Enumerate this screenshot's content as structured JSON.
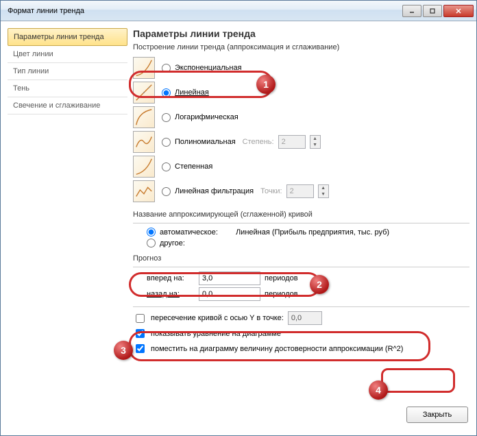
{
  "window": {
    "title": "Формат линии тренда"
  },
  "sidebar": {
    "items": [
      {
        "label": "Параметры линии тренда"
      },
      {
        "label": "Цвет линии"
      },
      {
        "label": "Тип линии"
      },
      {
        "label": "Тень"
      },
      {
        "label": "Свечение и сглаживание"
      }
    ]
  },
  "content": {
    "heading": "Параметры линии тренда",
    "build_group": "Построение линии тренда (аппроксимация и сглаживание)",
    "types": {
      "exponential": "Экспоненциальная",
      "linear": "Линейная",
      "log": "Логарифмическая",
      "poly": "Полиномиальная",
      "poly_degree_label": "Степень:",
      "poly_degree_value": "2",
      "power": "Степенная",
      "movavg": "Линейная фильтрация",
      "movavg_points_label": "Точки:",
      "movavg_points_value": "2"
    },
    "name_group": "Название аппроксимирующей (сглаженной) кривой",
    "name_auto": "автоматическое:",
    "name_auto_value": "Линейная (Прибыль предприятия, тыс. руб)",
    "name_other": "другое:",
    "forecast_group": "Прогноз",
    "forecast_forward": "вперед на:",
    "forecast_forward_value": "3,0",
    "forecast_back": "назад на:",
    "forecast_back_value": "0,0",
    "forecast_units": "периодов",
    "intercept_label": "пересечение кривой с осью Y в точке:",
    "intercept_value": "0,0",
    "show_equation": "показывать уравнение на диаграмме",
    "show_r2": "поместить на диаграмму величину достоверности аппроксимации (R^2)"
  },
  "footer": {
    "close": "Закрыть"
  },
  "annotations": {
    "marker1": "1",
    "marker2": "2",
    "marker3": "3",
    "marker4": "4"
  }
}
